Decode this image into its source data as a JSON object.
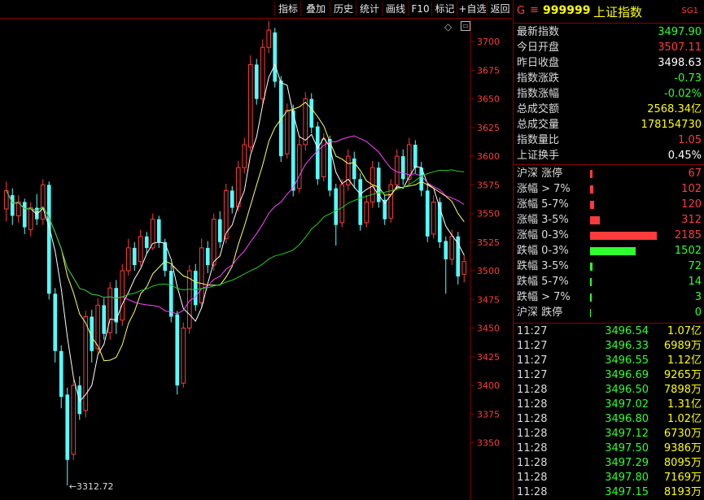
{
  "toolbar": {
    "buttons": [
      {
        "label": "指标"
      },
      {
        "label": "叠加"
      },
      {
        "label": "历史"
      },
      {
        "label": "统计"
      },
      {
        "label": "画线"
      },
      {
        "label": "F10"
      },
      {
        "label": "标记"
      },
      {
        "label": "+自选"
      },
      {
        "label": "返回"
      }
    ]
  },
  "header": {
    "g_label": "G",
    "menu_glyph": "≡",
    "code": "999999",
    "name": "上证指数",
    "sg_label": "SG1"
  },
  "stats": [
    {
      "label": "最新指数",
      "value": "3497.90",
      "color": "green"
    },
    {
      "label": "今日开盘",
      "value": "3507.11",
      "color": "red"
    },
    {
      "label": "昨日收盘",
      "value": "3498.63",
      "color": "white"
    },
    {
      "label": "指数涨跌",
      "value": "-0.73",
      "color": "green"
    },
    {
      "label": "指数涨幅",
      "value": "-0.02%",
      "color": "green"
    },
    {
      "label": "总成交额",
      "value": "2568.34亿",
      "color": "yellow"
    },
    {
      "label": "总成交量",
      "value": "178154730",
      "color": "yellow"
    },
    {
      "label": "指数量比",
      "value": "1.05",
      "color": "red"
    },
    {
      "label": "上证换手",
      "value": "0.45%",
      "color": "white"
    }
  ],
  "distribution": [
    {
      "label": "沪深 涨停",
      "value": "67",
      "color": "#ff3b3b"
    },
    {
      "label": "涨幅 > 7%",
      "value": "102",
      "color": "#ff3b3b"
    },
    {
      "label": "涨幅 5-7%",
      "value": "120",
      "color": "#ff3b3b"
    },
    {
      "label": "涨幅 3-5%",
      "value": "312",
      "color": "#ff3b3b"
    },
    {
      "label": "涨幅 0-3%",
      "value": "2185",
      "color": "#ff3b3b"
    },
    {
      "label": "跌幅 0-3%",
      "value": "1502",
      "color": "#2eff2e"
    },
    {
      "label": "跌幅 3-5%",
      "value": "72",
      "color": "#2eff2e"
    },
    {
      "label": "跌幅 5-7%",
      "value": "14",
      "color": "#2eff2e"
    },
    {
      "label": "跌幅 > 7%",
      "value": "3",
      "color": "#2eff2e"
    },
    {
      "label": "沪深 跌停",
      "value": "0",
      "color": "#2eff2e"
    }
  ],
  "ticks": [
    {
      "time": "11:27",
      "price": "3496.54",
      "vol": "1.07亿"
    },
    {
      "time": "11:27",
      "price": "3496.33",
      "vol": "6989万"
    },
    {
      "time": "11:27",
      "price": "3496.55",
      "vol": "1.12亿"
    },
    {
      "time": "11:27",
      "price": "3496.69",
      "vol": "9265万"
    },
    {
      "time": "11:28",
      "price": "3496.50",
      "vol": "7898万"
    },
    {
      "time": "11:28",
      "price": "3497.02",
      "vol": "1.31亿"
    },
    {
      "time": "11:28",
      "price": "3496.80",
      "vol": "1.02亿"
    },
    {
      "time": "11:28",
      "price": "3497.12",
      "vol": "6730万"
    },
    {
      "time": "11:28",
      "price": "3497.50",
      "vol": "9386万"
    },
    {
      "time": "11:28",
      "price": "3497.29",
      "vol": "8095万"
    },
    {
      "time": "11:28",
      "price": "3497.80",
      "vol": "7169万"
    },
    {
      "time": "11:28",
      "price": "3497.15",
      "vol": "8193万"
    }
  ],
  "chart_data": {
    "type": "candlestick",
    "ylim": [
      3300,
      3720
    ],
    "y_ticks": [
      3350,
      3375,
      3400,
      3425,
      3450,
      3475,
      3500,
      3525,
      3550,
      3575,
      3600,
      3625,
      3650,
      3675,
      3700
    ],
    "min_label": "3312.72",
    "colors": {
      "up": "#ff3b3b",
      "down": "#54ffff",
      "ma5": "#ffffff",
      "ma10": "#ffff66",
      "ma20": "#ff44ff",
      "ma60": "#22cc22",
      "axis": "#8b0000"
    },
    "candles": [
      [
        3554,
        3570,
        3543,
        3578
      ],
      [
        3566,
        3548,
        3540,
        3572
      ],
      [
        3548,
        3560,
        3542,
        3566
      ],
      [
        3560,
        3538,
        3532,
        3563
      ],
      [
        3536,
        3555,
        3530,
        3560
      ],
      [
        3555,
        3545,
        3540,
        3567
      ],
      [
        3545,
        3575,
        3540,
        3580
      ],
      [
        3575,
        3480,
        3475,
        3578
      ],
      [
        3480,
        3430,
        3420,
        3485
      ],
      [
        3430,
        3390,
        3380,
        3435
      ],
      [
        3392,
        3335,
        3312.72,
        3398
      ],
      [
        3340,
        3400,
        3335,
        3405
      ],
      [
        3400,
        3375,
        3370,
        3408
      ],
      [
        3378,
        3460,
        3372,
        3465
      ],
      [
        3460,
        3430,
        3420,
        3466
      ],
      [
        3432,
        3470,
        3428,
        3476
      ],
      [
        3470,
        3445,
        3440,
        3476
      ],
      [
        3446,
        3485,
        3440,
        3490
      ],
      [
        3485,
        3455,
        3445,
        3492
      ],
      [
        3457,
        3500,
        3452,
        3506
      ],
      [
        3500,
        3520,
        3496,
        3528
      ],
      [
        3520,
        3505,
        3500,
        3525
      ],
      [
        3508,
        3530,
        3504,
        3536
      ],
      [
        3530,
        3520,
        3515,
        3534
      ],
      [
        3520,
        3545,
        3518,
        3550
      ],
      [
        3545,
        3525,
        3520,
        3548
      ],
      [
        3525,
        3500,
        3495,
        3528
      ],
      [
        3500,
        3460,
        3455,
        3505
      ],
      [
        3462,
        3400,
        3392,
        3465
      ],
      [
        3402,
        3450,
        3398,
        3455
      ],
      [
        3450,
        3500,
        3445,
        3505
      ],
      [
        3500,
        3470,
        3465,
        3506
      ],
      [
        3472,
        3520,
        3468,
        3528
      ],
      [
        3520,
        3505,
        3498,
        3526
      ],
      [
        3505,
        3545,
        3500,
        3550
      ],
      [
        3545,
        3525,
        3520,
        3552
      ],
      [
        3528,
        3570,
        3524,
        3576
      ],
      [
        3570,
        3555,
        3550,
        3574
      ],
      [
        3556,
        3590,
        3552,
        3596
      ],
      [
        3590,
        3610,
        3585,
        3616
      ],
      [
        3608,
        3680,
        3604,
        3688
      ],
      [
        3680,
        3650,
        3645,
        3685
      ],
      [
        3650,
        3695,
        3646,
        3702
      ],
      [
        3695,
        3710,
        3690,
        3718
      ],
      [
        3708,
        3665,
        3660,
        3712
      ],
      [
        3666,
        3600,
        3595,
        3670
      ],
      [
        3602,
        3640,
        3598,
        3646
      ],
      [
        3640,
        3570,
        3565,
        3645
      ],
      [
        3572,
        3610,
        3568,
        3618
      ],
      [
        3610,
        3650,
        3605,
        3656
      ],
      [
        3650,
        3625,
        3620,
        3655
      ],
      [
        3626,
        3580,
        3575,
        3630
      ],
      [
        3582,
        3615,
        3578,
        3620
      ],
      [
        3615,
        3570,
        3565,
        3618
      ],
      [
        3572,
        3540,
        3522,
        3576
      ],
      [
        3542,
        3575,
        3538,
        3580
      ],
      [
        3575,
        3600,
        3570,
        3606
      ],
      [
        3598,
        3580,
        3572,
        3604
      ],
      [
        3580,
        3540,
        3535,
        3585
      ],
      [
        3542,
        3560,
        3538,
        3566
      ],
      [
        3560,
        3590,
        3555,
        3596
      ],
      [
        3590,
        3560,
        3555,
        3595
      ],
      [
        3562,
        3545,
        3540,
        3566
      ],
      [
        3546,
        3575,
        3542,
        3580
      ],
      [
        3575,
        3600,
        3570,
        3606
      ],
      [
        3600,
        3580,
        3575,
        3606
      ],
      [
        3580,
        3610,
        3575,
        3616
      ],
      [
        3610,
        3590,
        3585,
        3614
      ],
      [
        3590,
        3570,
        3565,
        3595
      ],
      [
        3570,
        3530,
        3525,
        3575
      ],
      [
        3532,
        3560,
        3528,
        3566
      ],
      [
        3560,
        3525,
        3520,
        3564
      ],
      [
        3526,
        3510,
        3480,
        3530
      ],
      [
        3510,
        3530,
        3505,
        3536
      ],
      [
        3530,
        3495,
        3488,
        3534
      ],
      [
        3497,
        3508,
        3490,
        3514
      ]
    ]
  }
}
